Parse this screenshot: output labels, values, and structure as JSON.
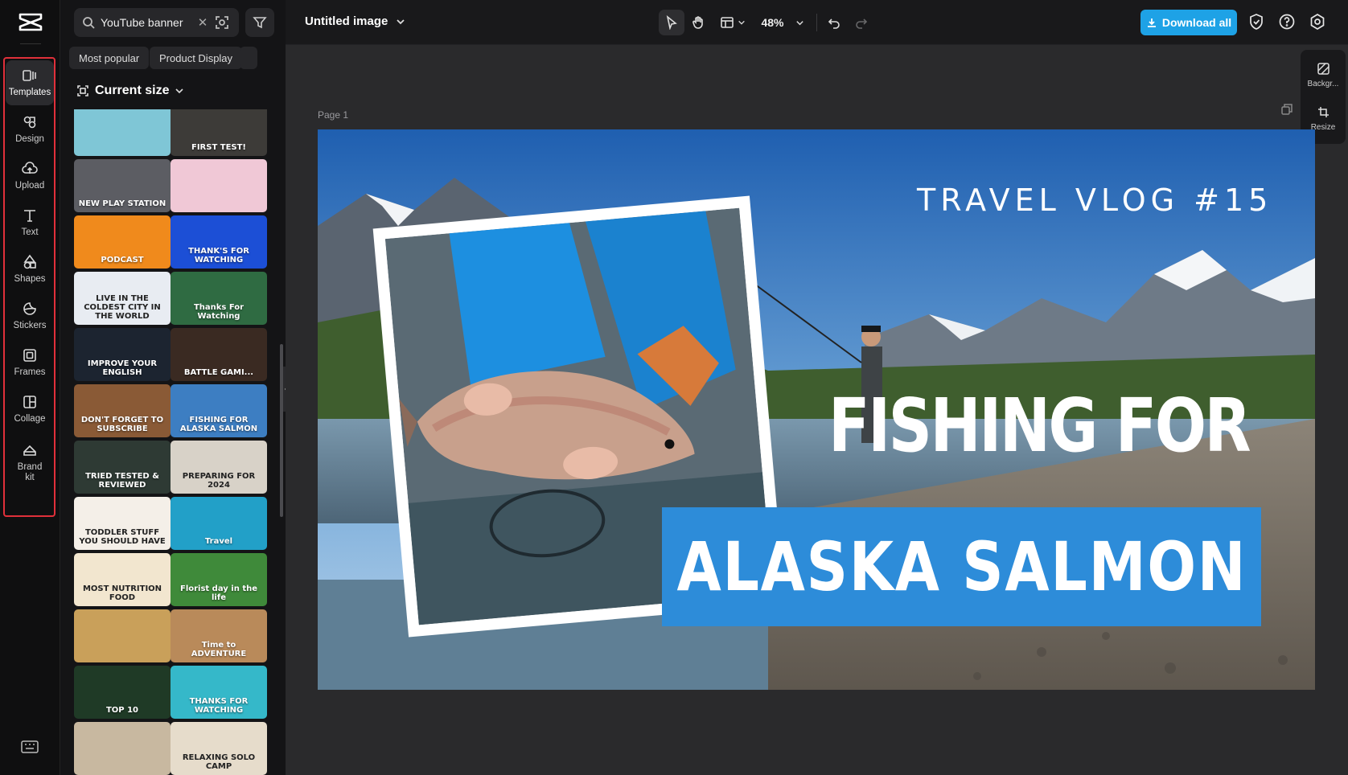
{
  "rail": {
    "items": [
      {
        "label": "Templates",
        "icon": "templates-icon"
      },
      {
        "label": "Design",
        "icon": "design-icon"
      },
      {
        "label": "Upload",
        "icon": "upload-cloud-icon"
      },
      {
        "label": "Text",
        "icon": "text-icon"
      },
      {
        "label": "Shapes",
        "icon": "shapes-icon"
      },
      {
        "label": "Stickers",
        "icon": "sticker-icon"
      },
      {
        "label": "Frames",
        "icon": "frame-icon"
      },
      {
        "label": "Collage",
        "icon": "collage-icon"
      },
      {
        "label": "Brand kit",
        "icon": "brand-kit-icon"
      }
    ]
  },
  "panel": {
    "search_value": "YouTube banner",
    "chips": [
      "Most popular",
      "Product Display"
    ],
    "size_label": "Current size",
    "thumbnails": [
      {
        "text": "",
        "bg": "#7fc6d6"
      },
      {
        "text": "FIRST TEST!",
        "bg": "#3d3b38"
      },
      {
        "text": "NEW PLAY STATION",
        "bg": "#5c5d63"
      },
      {
        "text": "",
        "bg": "#f0c8d6"
      },
      {
        "text": "PODCAST",
        "bg": "#f08a1c"
      },
      {
        "text": "THANK'S FOR WATCHING",
        "bg": "#1c4fd6"
      },
      {
        "text": "LIVE IN THE COLDEST CITY IN THE WORLD",
        "bg": "#e8ecf2"
      },
      {
        "text": "Thanks For Watching",
        "bg": "#2f6b42"
      },
      {
        "text": "IMPROVE YOUR ENGLISH",
        "bg": "#1c2430"
      },
      {
        "text": "BATTLE GAMI...",
        "bg": "#3a2a22"
      },
      {
        "text": "DON'T FORGET TO SUBSCRIBE",
        "bg": "#8a5a36"
      },
      {
        "text": "FISHING FOR ALASKA SALMON",
        "bg": "#3d7ec2"
      },
      {
        "text": "TRIED TESTED & REVIEWED",
        "bg": "#2e3a34"
      },
      {
        "text": "PREPARING FOR 2024",
        "bg": "#d8d2c8"
      },
      {
        "text": "TODDLER STUFF YOU SHOULD HAVE",
        "bg": "#f4efe8"
      },
      {
        "text": "Travel",
        "bg": "#22a0c8"
      },
      {
        "text": "MOST NUTRITION FOOD",
        "bg": "#f2e6cf"
      },
      {
        "text": "Florist day in the life",
        "bg": "#3f8a3a"
      },
      {
        "text": "",
        "bg": "#c9a05a"
      },
      {
        "text": "Time to ADVENTURE",
        "bg": "#b98a5a"
      },
      {
        "text": "TOP 10",
        "bg": "#1f3a26"
      },
      {
        "text": "THANKS FOR WATCHING",
        "bg": "#35b8c9"
      },
      {
        "text": "",
        "bg": "#c8b8a0"
      },
      {
        "text": "RELAXING SOLO CAMP",
        "bg": "#e6dccb"
      }
    ]
  },
  "topbar": {
    "doc_title": "Untitled image",
    "zoom": "48%",
    "download_label": "Download all"
  },
  "canvas": {
    "page_label": "Page 1",
    "right_tools": [
      {
        "label": "Backgr...",
        "icon": "background-icon"
      },
      {
        "label": "Resize",
        "icon": "resize-icon"
      }
    ],
    "vlog_title": "TRAVEL VLOG #15",
    "headline_1": "FISHING FOR",
    "headline_2": "ALASKA SALMON",
    "accent_color": "#2d8cd9"
  },
  "colors": {
    "primary_button": "#1ea2e6",
    "highlight_box": "#e0303a"
  }
}
